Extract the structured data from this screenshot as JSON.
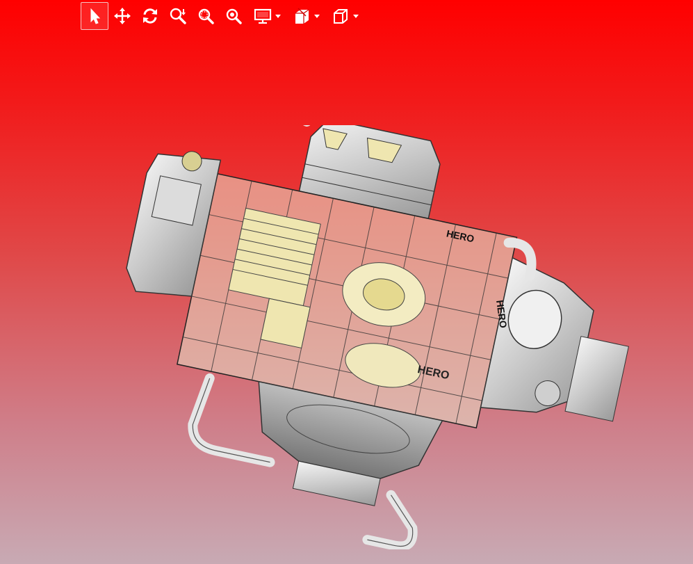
{
  "toolbar": {
    "tools": [
      {
        "id": "select",
        "icon": "cursor-arrow-icon",
        "active": true
      },
      {
        "id": "pan",
        "icon": "move-arrows-icon"
      },
      {
        "id": "rotate",
        "icon": "rotate-icon"
      },
      {
        "id": "zoom-dynamic",
        "icon": "zoom-dynamic-icon"
      },
      {
        "id": "zoom-window",
        "icon": "zoom-window-icon"
      },
      {
        "id": "zoom-fit",
        "icon": "zoom-fit-icon"
      },
      {
        "id": "display-mode",
        "icon": "monitor-icon",
        "dropdown": true
      },
      {
        "id": "section-view",
        "icon": "section-view-icon",
        "dropdown": true
      },
      {
        "id": "view-orientation",
        "icon": "cube-icon",
        "dropdown": true
      }
    ]
  },
  "model": {
    "brand_labels": [
      "HERO",
      "HERO",
      "HERO"
    ]
  },
  "colors": {
    "background_top": "#ff0000",
    "background_bottom": "#c8aab4",
    "toolbar_icon": "#ffffff",
    "part_metal": "#d9d9d9",
    "part_yellow": "#efe6b0"
  }
}
